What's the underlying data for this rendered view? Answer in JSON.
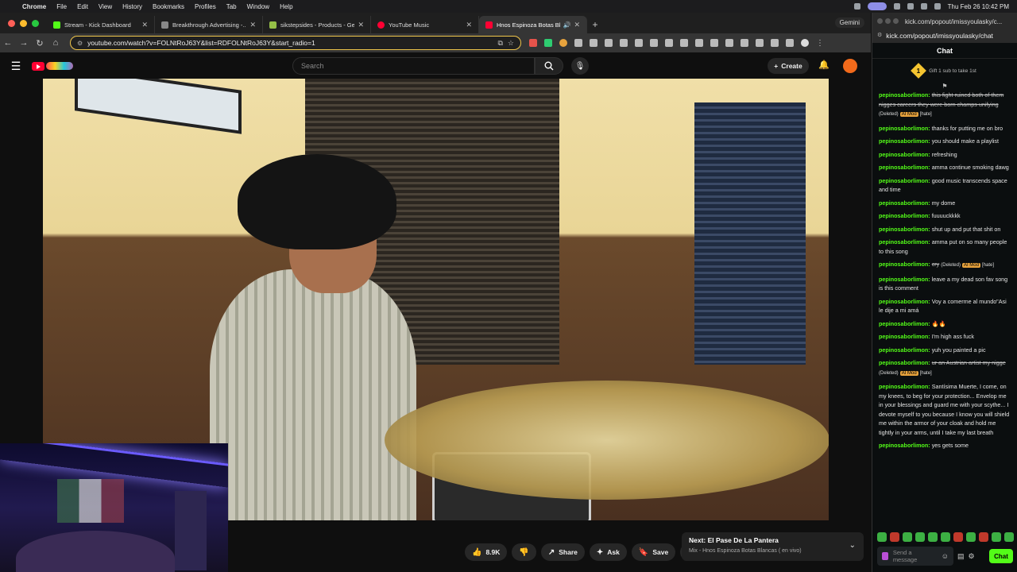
{
  "menubar": {
    "app": "Chrome",
    "items": [
      "File",
      "Edit",
      "View",
      "History",
      "Bookmarks",
      "Profiles",
      "Tab",
      "Window",
      "Help"
    ],
    "clock": "Thu Feb 26  10:42 PM"
  },
  "tabs": [
    {
      "label": "Stream - Kick Dashboard",
      "color": "#53fc18"
    },
    {
      "label": "Breakthrough Advertising -...",
      "color": "#888888"
    },
    {
      "label": "sikstepsides - Products - Gel...",
      "color": "#95bf47"
    },
    {
      "label": "YouTube Music",
      "color": "#ff0033"
    },
    {
      "label": "Hnos Espinoza Botas Blan...",
      "color": "#ff0033"
    }
  ],
  "gemini_label": "Gemini",
  "address": {
    "url": "youtube.com/watch?v=FOLNtRoJ63Y&list=RDFOLNtRoJ63Y&start_radio=1"
  },
  "youtube": {
    "search_placeholder": "Search",
    "create_label": "Create",
    "actions": {
      "likes": "8.9K",
      "share": "Share",
      "ask": "Ask",
      "save": "Save"
    },
    "next": {
      "title": "Next: El Pase De La Pantera",
      "subtitle": "Mix - Hnos Espinoza Botas Blancas ( en vivo)"
    }
  },
  "chat": {
    "window_url": "kick.com/popout/imissyoulasky/c...",
    "url": "kick.com/popout/imissyoulasky/chat",
    "header": "Chat",
    "gift_count": "1",
    "gift_text": "Gift 1 sub to take 1st",
    "input_placeholder": "Send a message",
    "send_label": "Chat",
    "messages": [
      {
        "user": "pepinosaborlimon:",
        "text": "this fight ruined both of them nigges careers they were born champs unifying",
        "deleted": true,
        "extra": "(Deleted)",
        "mod": "AI Mod",
        "tag": "[hate]"
      },
      {
        "user": "pepinosaborlimon:",
        "text": "thanks for putting me on bro"
      },
      {
        "user": "pepinosaborlimon:",
        "text": "you should make a playlist"
      },
      {
        "user": "pepinosaborlimon:",
        "text": "refreshing"
      },
      {
        "user": "pepinosaborlimon:",
        "text": "amma continue smoking dawg"
      },
      {
        "user": "pepinosaborlimon:",
        "text": "good music transcends space and time"
      },
      {
        "user": "pepinosaborlimon:",
        "text": "my dome"
      },
      {
        "user": "pepinosaborlimon:",
        "text": "fuuuuckkkk"
      },
      {
        "user": "pepinosaborlimon:",
        "text": "shut up and put that shit on"
      },
      {
        "user": "pepinosaborlimon:",
        "text": "amma put on so many people to this song"
      },
      {
        "user": "pepinosaborlimon:",
        "text": "cry",
        "deleted": true,
        "extra": "(Deleted)",
        "mod": "AI Mod",
        "tag": "[hate]"
      },
      {
        "user": "pepinosaborlimon:",
        "text": "leave a my dead son fav song is this comment"
      },
      {
        "user": "pepinosaborlimon:",
        "text": "Voy a comerme al mundo\"Asi le dije a mi amá"
      },
      {
        "user": "pepinosaborlimon:",
        "text": "🔥🔥"
      },
      {
        "user": "pepinosaborlimon:",
        "text": "I'm high ass fuck"
      },
      {
        "user": "pepinosaborlimon:",
        "text": "yuh you painted a pic"
      },
      {
        "user": "pepinosaborlimon:",
        "text": "ur an Austrian artist my nigge",
        "deleted": true,
        "extra": "(Deleted)",
        "mod": "AI Mod",
        "tag": "[hate]"
      },
      {
        "user": "pepinosaborlimon:",
        "text": "Santísima Muerte, I come, on my knees, to beg for your protection... Envelop me in your blessings and guard me with your scythe... I devote myself to you because I know you will shield me within the armor of your cloak and hold me tightly in your arms, until I take my last breath"
      },
      {
        "user": "pepinosaborlimon:",
        "text": "yes gets some"
      }
    ]
  }
}
